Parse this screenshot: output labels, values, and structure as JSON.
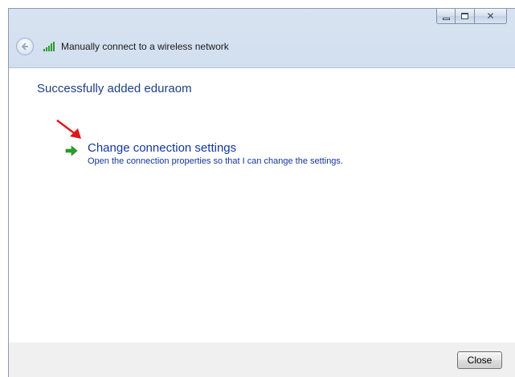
{
  "window": {
    "caption_buttons": {
      "minimize": "minimize-icon",
      "maximize": "maximize-icon",
      "close": "close-icon"
    }
  },
  "header": {
    "title": "Manually connect to a wireless network",
    "back_icon": "back-arrow-icon",
    "network_icon": "wireless-signal-icon"
  },
  "content": {
    "heading": "Successfully added eduraom",
    "option": {
      "title": "Change connection settings",
      "description": "Open the connection properties so that I can change the settings.",
      "icon": "green-arrow-icon"
    },
    "annotation_icon": "red-arrow-icon"
  },
  "footer": {
    "close_label": "Close"
  },
  "colors": {
    "heading": "#1e3f8a",
    "link": "#14369c",
    "annotation": "#e0161b",
    "arrow_green": "#2aa12a"
  }
}
